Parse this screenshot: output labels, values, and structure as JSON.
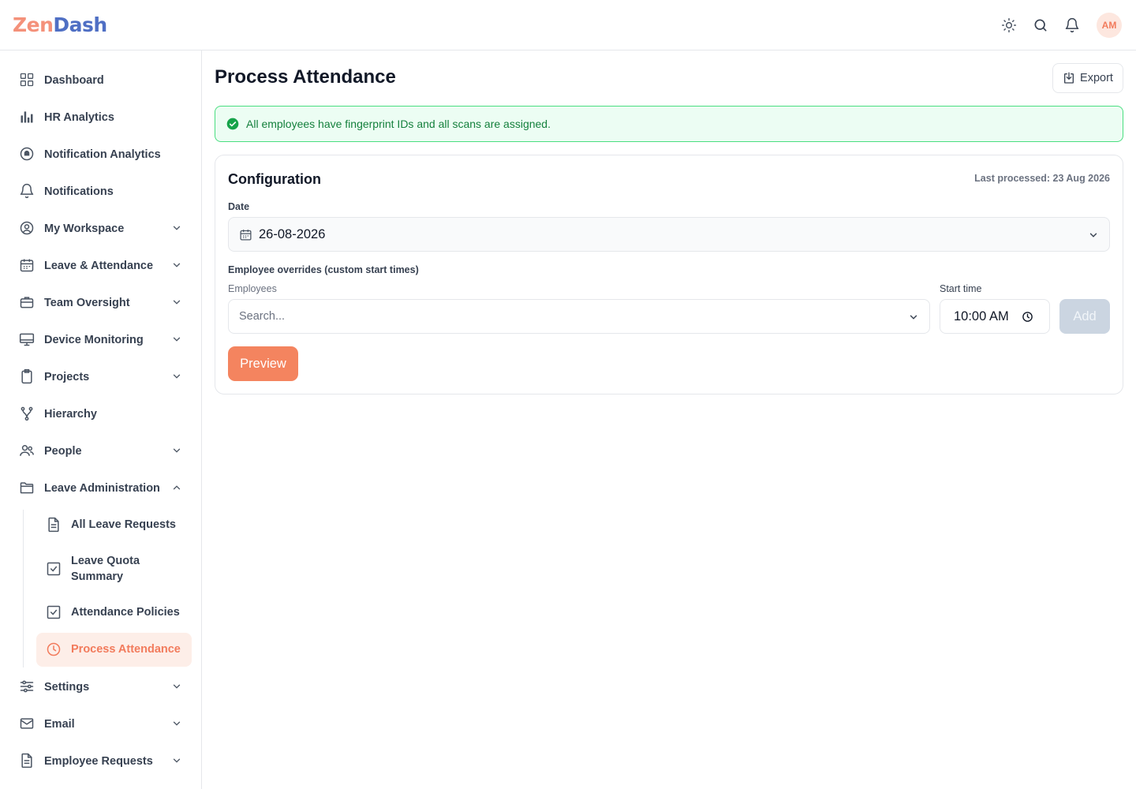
{
  "app": {
    "logo_part1": "Zen",
    "logo_part2": "Dash",
    "avatar_initials": "AM"
  },
  "sidebar": {
    "items": [
      {
        "label": "Dashboard",
        "icon": "grid-icon"
      },
      {
        "label": "HR Analytics",
        "icon": "bar-chart-icon"
      },
      {
        "label": "Notification Analytics",
        "icon": "bell-circle-icon"
      },
      {
        "label": "Notifications",
        "icon": "bell-icon"
      },
      {
        "label": "My Workspace",
        "icon": "user-circle-icon"
      },
      {
        "label": "Leave & Attendance",
        "icon": "calendar-icon"
      },
      {
        "label": "Team Oversight",
        "icon": "briefcase-icon"
      },
      {
        "label": "Device Monitoring",
        "icon": "monitor-icon"
      },
      {
        "label": "Projects",
        "icon": "clipboard-icon"
      },
      {
        "label": "Hierarchy",
        "icon": "branch-icon"
      },
      {
        "label": "People",
        "icon": "users-icon"
      },
      {
        "label": "Leave Administration",
        "icon": "folder-icon"
      },
      {
        "label": "Settings",
        "icon": "sliders-icon"
      },
      {
        "label": "Email",
        "icon": "mail-icon"
      },
      {
        "label": "Employee Requests",
        "icon": "document-icon"
      }
    ],
    "sub_items": [
      {
        "label": "All Leave Requests",
        "icon": "document-icon"
      },
      {
        "label": "Leave Quota Summary",
        "icon": "checkbox-icon"
      },
      {
        "label": "Attendance Policies",
        "icon": "checkbox-icon"
      },
      {
        "label": "Process Attendance",
        "icon": "clock-icon"
      }
    ]
  },
  "main": {
    "title": "Process Attendance",
    "export_label": "Export",
    "alert_text": "All employees have fingerprint IDs and all scans are assigned.",
    "card": {
      "title": "Configuration",
      "last_processed": "Last processed: 23 Aug 2026",
      "date_label": "Date",
      "date_value": "26-08-2026",
      "overrides_label": "Employee overrides (custom start times)",
      "employees_label": "Employees",
      "employees_placeholder": "Search...",
      "start_time_label": "Start time",
      "start_time_value": "10:00 AM",
      "add_label": "Add",
      "preview_label": "Preview"
    }
  },
  "colors": {
    "accent": "#f4845f",
    "accent_soft": "#fdeee8",
    "success": "#15803d",
    "success_bg": "#ecfdf3",
    "brand_blue": "#4f6fc4"
  }
}
